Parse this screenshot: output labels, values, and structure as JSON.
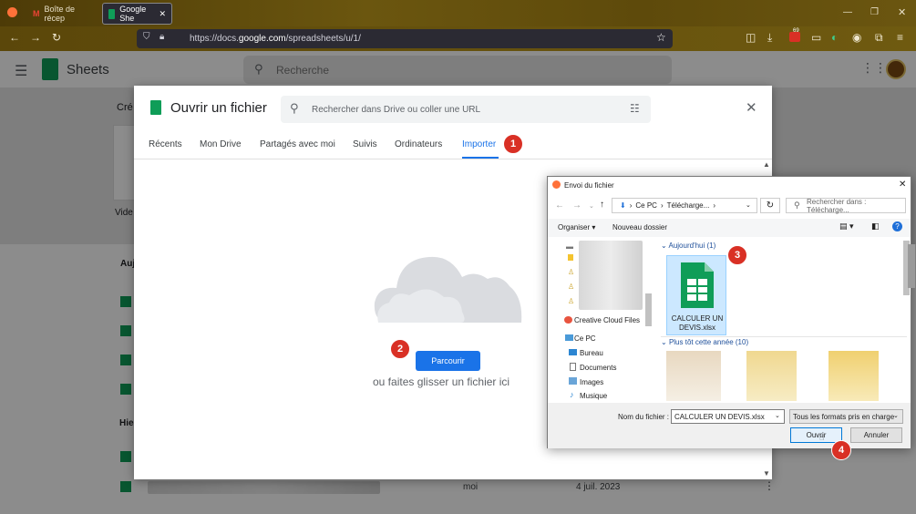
{
  "browser": {
    "tabs": [
      {
        "label": "Boîte de récep"
      },
      {
        "label": "Google She"
      }
    ],
    "url_prefix": "https://docs.",
    "url_host": "google.com",
    "url_suffix": "/spreadsheets/u/1/",
    "badge": "69"
  },
  "sheets": {
    "app_title": "Sheets",
    "search_placeholder": "Recherche",
    "bg_labels": [
      "Cré",
      "Vide",
      "Auj",
      "Hier"
    ],
    "bg_owner": "moi",
    "bg_date": "4 juil. 2023"
  },
  "picker": {
    "title": "Ouvrir un fichier",
    "search_placeholder": "Rechercher dans Drive ou coller une URL",
    "tabs": [
      "Récents",
      "Mon Drive",
      "Partagés avec moi",
      "Suivis",
      "Ordinateurs",
      "Importer"
    ],
    "browse_label": "Parcourir",
    "drag_text": "ou faites glisser un fichier ici"
  },
  "markers": [
    "1",
    "2",
    "3",
    "4"
  ],
  "file_dialog": {
    "title": "Envoi du fichier",
    "breadcrumb": [
      "Ce PC",
      "Télécharge..."
    ],
    "search_placeholder": "Rechercher dans : Télécharge...",
    "organize_label": "Organiser",
    "new_folder_label": "Nouveau dossier",
    "nav_items": [
      "Creative Cloud Files",
      "Ce PC",
      "Bureau",
      "Documents",
      "Images",
      "Musique"
    ],
    "group_today": "Aujourd'hui (1)",
    "group_earlier": "Plus tôt cette année (10)",
    "selected_file": "CALCULER UN DEVIS.xlsx",
    "filename_label": "Nom du fichier :",
    "filename_value": "CALCULER UN DEVIS.xlsx",
    "filetype_value": "Tous les formats pris en charge",
    "open_label": "Ouvrir",
    "cancel_label": "Annuler"
  },
  "colors": {
    "accent": "#1a73e8",
    "marker": "#d93025",
    "sheets_green": "#0f9d58"
  }
}
